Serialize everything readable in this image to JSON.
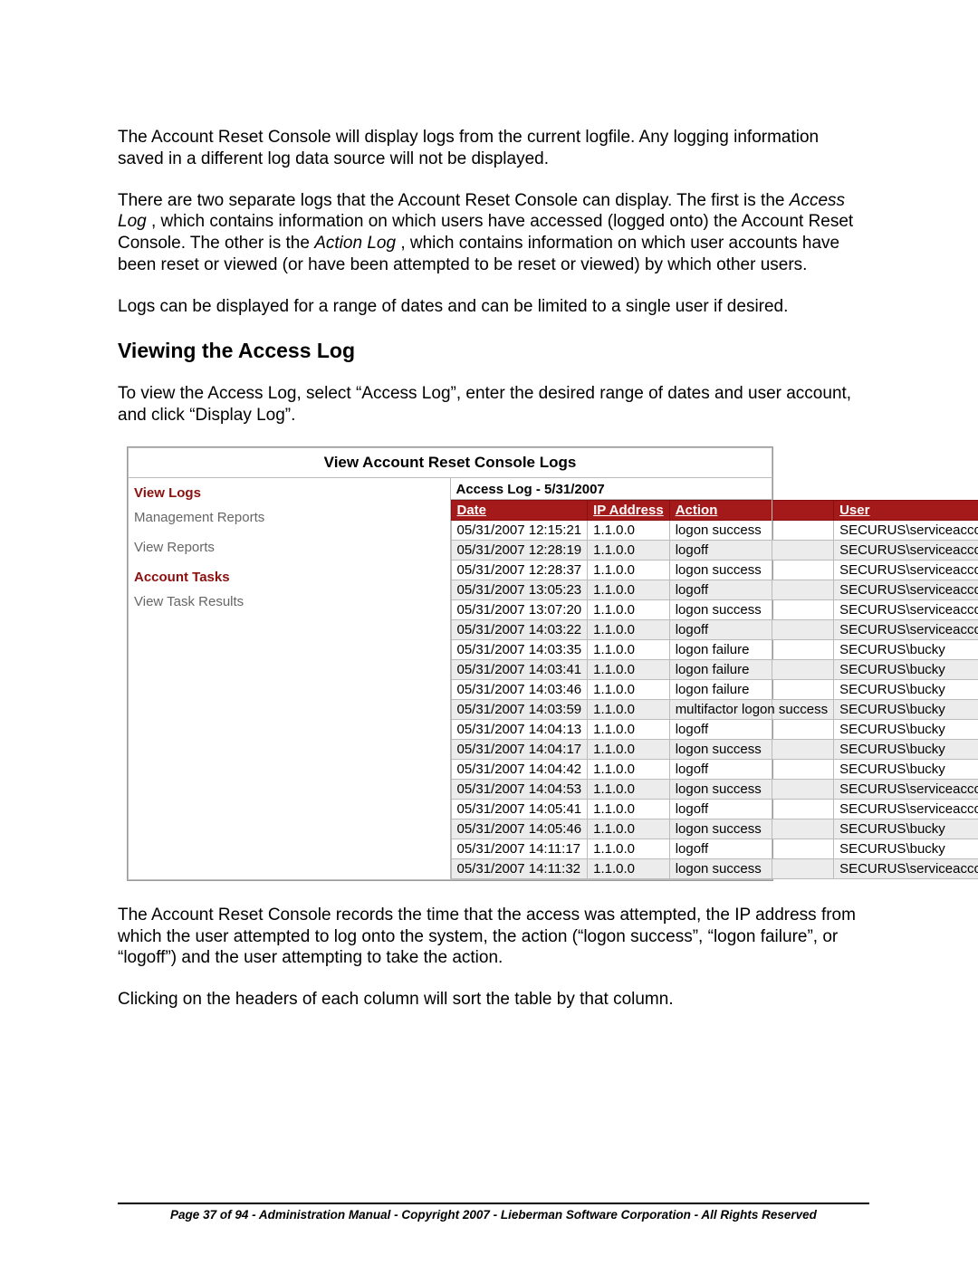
{
  "paragraphs": {
    "p1": "The Account Reset Console will display logs from the current logfile.  Any logging information saved in a different log data source will not be displayed.",
    "p2a": "There are two separate logs that the Account Reset Console can display.  The first is the ",
    "p2_access_log": "Access Log",
    "p2b": ", which contains information on which users have accessed (logged onto) the Account Reset Console.  The other is the ",
    "p2_action_log": "Action Log",
    "p2c": ", which contains information on which user accounts have been reset or viewed (or have been attempted to be reset or viewed) by which other users.",
    "p3": "Logs can be displayed for a range of dates and can be limited to a single user if desired.",
    "p4": "To view the Access Log, select “Access Log”, enter the desired range of dates and user account, and click “Display Log”.",
    "p5": "The Account Reset Console records the time that the access was attempted, the IP address from which the user attempted to log onto the system, the action (“logon success”, “logon failure”, or “logoff”) and the user attempting to take the action.",
    "p6": "Clicking on the headers of each column will sort the table by that column."
  },
  "heading": "Viewing the Access Log",
  "panel": {
    "title": "View Account Reset Console Logs",
    "sidebar": {
      "view_logs": "View Logs",
      "mgmt_reports": "Management Reports",
      "view_reports": "View Reports",
      "account_tasks": "Account Tasks",
      "view_task_results": "View Task Results"
    },
    "content_header": "Access Log - 5/31/2007",
    "columns": {
      "date": "Date",
      "ip": "IP Address",
      "action": "Action",
      "user": "User"
    },
    "rows": [
      {
        "date": "05/31/2007 12:15:21",
        "ip": "1.1.0.0",
        "action": "logon success",
        "user": "SECURUS\\serviceaccount"
      },
      {
        "date": "05/31/2007 12:28:19",
        "ip": "1.1.0.0",
        "action": "logoff",
        "user": "SECURUS\\serviceaccount"
      },
      {
        "date": "05/31/2007 12:28:37",
        "ip": "1.1.0.0",
        "action": "logon success",
        "user": "SECURUS\\serviceaccount"
      },
      {
        "date": "05/31/2007 13:05:23",
        "ip": "1.1.0.0",
        "action": "logoff",
        "user": "SECURUS\\serviceaccount"
      },
      {
        "date": "05/31/2007 13:07:20",
        "ip": "1.1.0.0",
        "action": "logon success",
        "user": "SECURUS\\serviceaccount"
      },
      {
        "date": "05/31/2007 14:03:22",
        "ip": "1.1.0.0",
        "action": "logoff",
        "user": "SECURUS\\serviceaccount"
      },
      {
        "date": "05/31/2007 14:03:35",
        "ip": "1.1.0.0",
        "action": "logon failure",
        "user": "SECURUS\\bucky"
      },
      {
        "date": "05/31/2007 14:03:41",
        "ip": "1.1.0.0",
        "action": "logon failure",
        "user": "SECURUS\\bucky"
      },
      {
        "date": "05/31/2007 14:03:46",
        "ip": "1.1.0.0",
        "action": "logon failure",
        "user": "SECURUS\\bucky"
      },
      {
        "date": "05/31/2007 14:03:59",
        "ip": "1.1.0.0",
        "action": "multifactor logon success",
        "user": "SECURUS\\bucky"
      },
      {
        "date": "05/31/2007 14:04:13",
        "ip": "1.1.0.0",
        "action": "logoff",
        "user": "SECURUS\\bucky"
      },
      {
        "date": "05/31/2007 14:04:17",
        "ip": "1.1.0.0",
        "action": "logon success",
        "user": "SECURUS\\bucky"
      },
      {
        "date": "05/31/2007 14:04:42",
        "ip": "1.1.0.0",
        "action": "logoff",
        "user": "SECURUS\\bucky"
      },
      {
        "date": "05/31/2007 14:04:53",
        "ip": "1.1.0.0",
        "action": "logon success",
        "user": "SECURUS\\serviceaccount"
      },
      {
        "date": "05/31/2007 14:05:41",
        "ip": "1.1.0.0",
        "action": "logoff",
        "user": "SECURUS\\serviceaccount"
      },
      {
        "date": "05/31/2007 14:05:46",
        "ip": "1.1.0.0",
        "action": "logon success",
        "user": "SECURUS\\bucky"
      },
      {
        "date": "05/31/2007 14:11:17",
        "ip": "1.1.0.0",
        "action": "logoff",
        "user": "SECURUS\\bucky"
      },
      {
        "date": "05/31/2007 14:11:32",
        "ip": "1.1.0.0",
        "action": "logon success",
        "user": "SECURUS\\serviceaccount"
      }
    ]
  },
  "footer": "Page 37 of 94 - Administration Manual - Copyright 2007 - Lieberman Software Corporation - All Rights Reserved"
}
